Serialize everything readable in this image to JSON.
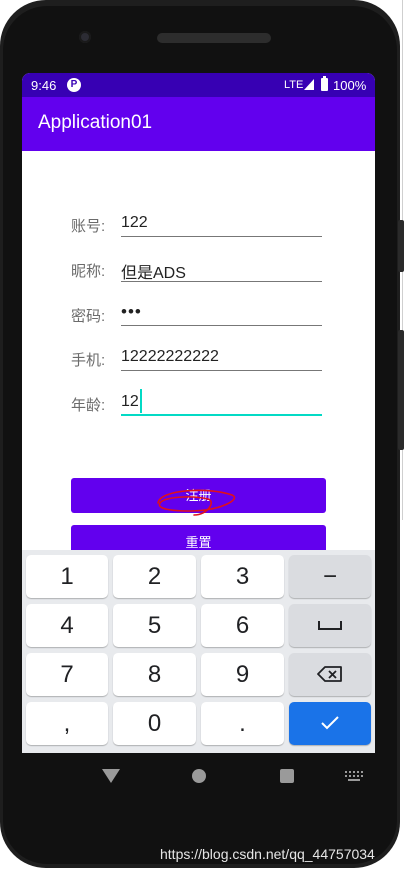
{
  "status_bar": {
    "time": "9:46",
    "network": "LTE",
    "battery": "100%"
  },
  "app_bar": {
    "title": "Application01"
  },
  "form": {
    "fields": [
      {
        "label": "账号:",
        "value": "122"
      },
      {
        "label": "昵称:",
        "value": "但是ADS"
      },
      {
        "label": "密码:",
        "value": "•••"
      },
      {
        "label": "手机:",
        "value": "12222222222"
      },
      {
        "label": "年龄:",
        "value": "12"
      }
    ],
    "register_button": "注册",
    "reset_button": "重置"
  },
  "keyboard": {
    "keys": [
      "1",
      "2",
      "3",
      "−",
      "4",
      "5",
      "6",
      "␣",
      "7",
      "8",
      "9",
      "⌫",
      ",",
      "0",
      ".",
      "✓"
    ]
  },
  "colors": {
    "status_bar": "#3700b3",
    "app_bar": "#6200ee",
    "button": "#6200ee",
    "focus_underline": "#03dac5",
    "keyboard_done": "#1a73e8",
    "annotation": "#e0101a"
  },
  "watermark": "https://blog.csdn.net/qq_44757034"
}
